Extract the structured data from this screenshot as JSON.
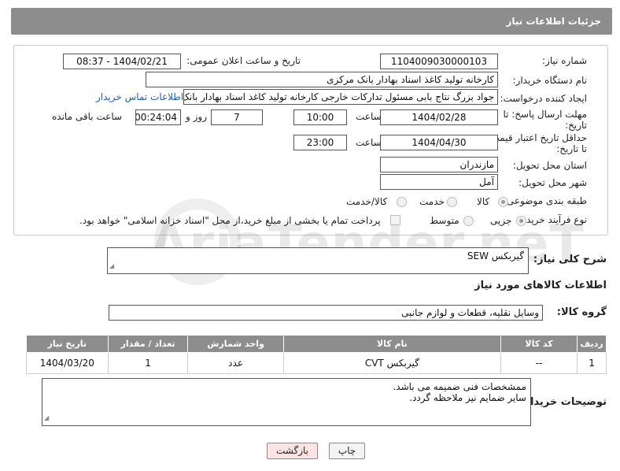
{
  "header": {
    "title": "جزئیات اطلاعات نیاز"
  },
  "form": {
    "need_number_label": "شماره نیاز:",
    "need_number": "1104009030000103",
    "announce_label": "تاریخ و ساعت اعلان عمومی:",
    "announce_value": "1404/02/21 - 08:37",
    "buyer_org_label": "نام دستگاه خریدار:",
    "buyer_org": "کارخانه تولید کاغذ اسناد بهادار بانک مرکزی",
    "creator_label": "ایجاد کننده درخواست:",
    "creator": "جواد بزرگ نتاج بابی مسئول تدارکات خارجی کارخانه تولید کاغذ اسناد بهادار بانک مرکزی",
    "contact_link": "اطلاعات تماس خریدار",
    "reply_deadline_label_1": "مهلت ارسال پاسخ: تا",
    "reply_deadline_label_2": "تاریخ:",
    "reply_date": "1404/02/28",
    "time_label": "ساعت",
    "reply_time": "10:00",
    "days_value": "7",
    "days_label": "روز و",
    "remaining_value": "00:24:04",
    "remaining_label": "ساعت باقی مانده",
    "price_valid_label_1": "حداقل تاریخ اعتبار قیمت:",
    "price_valid_label_2": "تا تاریخ:",
    "price_valid_date": "1404/04/30",
    "price_valid_time": "23:00",
    "province_label": "استان محل تحویل:",
    "province": "مازندران",
    "city_label": "شهر محل تحویل:",
    "city": "آمل",
    "category_label": "طبقه بندی موضوعی:",
    "category_options": [
      "کالا",
      "خدمت",
      "کالا/خدمت"
    ],
    "category_selected": "کالا",
    "process_label": "نوع فرآیند خرید :",
    "process_options": [
      "جزیی",
      "متوسط"
    ],
    "process_selected": "جزیی",
    "payment_note": "پرداخت تمام یا بخشی از مبلغ خرید،از محل \"اسناد خزانه اسلامی\" خواهد بود."
  },
  "summary": {
    "label": "شرح کلی نیاز:",
    "value": "گیربکس SEW"
  },
  "goods": {
    "section_title": "اطلاعات کالاهای مورد نیاز",
    "group_label": "گروه کالا:",
    "group_value": "وسایل نقلیه، قطعات و لوازم جانبی",
    "columns": [
      "ردیف",
      "کد کالا",
      "نام کالا",
      "واحد شمارش",
      "تعداد / مقدار",
      "تاریخ نیاز"
    ],
    "rows": [
      [
        "1",
        "--",
        "گیربکس CVT",
        "عدد",
        "1",
        "1404/03/20"
      ]
    ]
  },
  "buyer_notes": {
    "label": "توضیحات خریدار:",
    "line1": "ممشخصات فنی ضمیمه می باشد.",
    "line2": "سایر ضمایم نیز ملاحظه گردد."
  },
  "buttons": {
    "print": "چاپ",
    "back": "بازگشت"
  },
  "watermark": {
    "text": "AriaTender.neT"
  },
  "colors": {
    "header_bg": "#8d8d8d",
    "link": "#1f5fa8",
    "back_button_bg": "#fde4e4"
  }
}
